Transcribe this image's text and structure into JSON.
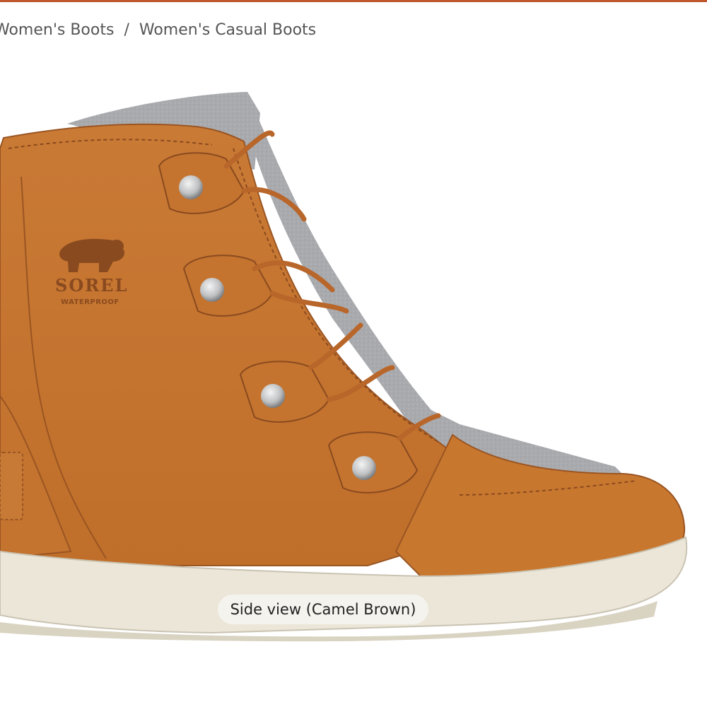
{
  "colors": {
    "accent": "#c0562a",
    "leather": "#c7772f",
    "leather_dark": "#8a4a1f",
    "felt": "#a8a9ad",
    "sole": "#ebe6d8"
  },
  "breadcrumb": {
    "items": [
      {
        "label": "Women's Boots"
      },
      {
        "label": "Women's Casual Boots"
      }
    ],
    "separator": "/"
  },
  "product_image": {
    "brand_logo": {
      "line1": "SOREL",
      "line2": "WATERPROOF"
    },
    "icon": "bear-logo-icon"
  },
  "caption": {
    "label": "Side view (Camel Brown)"
  }
}
